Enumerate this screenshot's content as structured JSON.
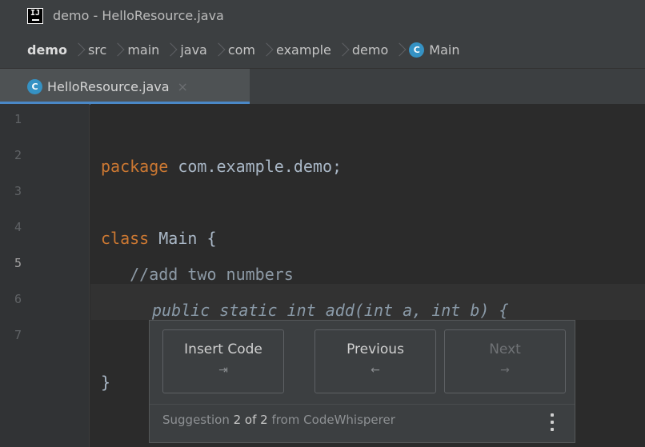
{
  "window": {
    "title": "demo - HelloResource.java",
    "logo_text": "IJ"
  },
  "breadcrumb": [
    "demo",
    "src",
    "main",
    "java",
    "com",
    "example",
    "demo",
    "Main"
  ],
  "class_icon_letter": "C",
  "tab": {
    "label": "HelloResource.java",
    "close": "×"
  },
  "gutter": {
    "lines": [
      "1",
      "2",
      "3",
      "4",
      "5",
      "6",
      "7"
    ],
    "current": "5"
  },
  "code": {
    "line1_kw": "package",
    "line1_rest": " com.example.demo;",
    "line3_kw": "class",
    "line3_rest": " Main {",
    "line4": "   //add two numbers",
    "line5": "public static int add(int a, int b) {",
    "line7": "}"
  },
  "popup": {
    "insert_label": "Insert Code",
    "insert_key": "⇥",
    "previous_label": "Previous",
    "previous_key": "←",
    "next_label": "Next",
    "next_key": "→",
    "status_prefix": "Suggestion ",
    "status_count": "2 of 2",
    "status_suffix": " from CodeWhisperer"
  },
  "colors": {
    "accent": "#4a88c7",
    "keyword": "#cc7832",
    "class_icon": "#3592c4"
  }
}
